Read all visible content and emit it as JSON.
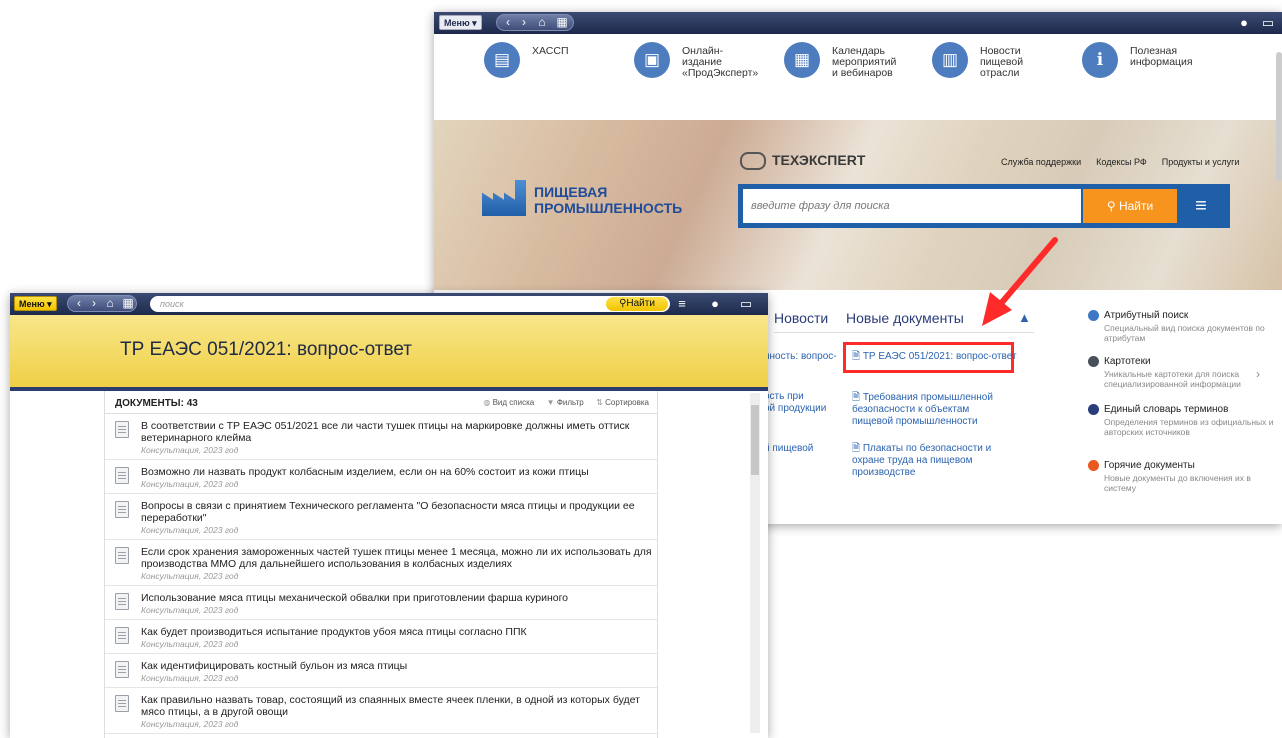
{
  "back_window": {
    "toolbar": {
      "menu_label": "Меню ▾"
    },
    "categories": [
      {
        "icon": "folder-icon",
        "glyph": "▤",
        "label": "ХАССП"
      },
      {
        "icon": "monitor-icon",
        "glyph": "▣",
        "label": "Онлайн-издание\n«ПродЭксперт»"
      },
      {
        "icon": "calendar-icon",
        "glyph": "▦",
        "label": "Календарь\nмероприятий\nи вебинаров"
      },
      {
        "icon": "news-icon",
        "glyph": "▥",
        "label": "Новости пищевой\nотрасли"
      },
      {
        "icon": "info-icon",
        "glyph": "ℹ",
        "label": "Полезная\nинформация"
      }
    ],
    "banner": {
      "brand": "ТЕХЭКСПЕRТ",
      "logo_line1": "ПИЩЕВАЯ",
      "logo_line2": "ПРОМЫШЛЕННОСТЬ",
      "links": [
        "Служба поддержки",
        "Кодексы РФ",
        "Продукты и услуги"
      ],
      "search_placeholder": "введите фразу для поиска",
      "search_button": "Найти"
    },
    "tabs": {
      "news": "Новости",
      "new_docs": "Новые документы"
    },
    "news_items": [
      "нность: вопрос-",
      "ость при\nой продукции",
      "й пищевой"
    ],
    "new_docs": [
      "ТР ЕАЭС 051/2021: вопрос-ответ",
      "Требования промышленной безопасности к объектам пищевой промышленности",
      "Плакаты по безопасности и охране труда на пищевом производстве"
    ],
    "side": [
      {
        "title": "Атрибутный поиск",
        "desc": "Специальный вид поиска документов по атрибутам",
        "color": "#3d78c4"
      },
      {
        "title": "Картотеки",
        "desc": "Уникальные картотеки для поиска специализированной информации",
        "color": "#4a4f5c"
      },
      {
        "title": "Единый словарь терминов",
        "desc": "Определения терминов из официальных и авторских источников",
        "color": "#2b3c7a"
      },
      {
        "title": "Горячие документы",
        "desc": "Новые документы до включения их в систему",
        "color": "#e8581f"
      }
    ]
  },
  "front_window": {
    "toolbar": {
      "menu_label": "Меню ▾",
      "search_placeholder": "поиск",
      "find_button": "Найти"
    },
    "page_title": "ТР ЕАЭС 051/2021: вопрос-ответ",
    "docs_header": "ДОКУМЕНТЫ: 43",
    "view_list": "Вид списка",
    "filter": "Фильтр",
    "sort": "Сортировка",
    "documents": [
      {
        "title": "В соответствии с ТР ЕАЭС 051/2021 все ли части тушек птицы на маркировке должны иметь оттиск ветеринарного клейма",
        "sub": "Консультация, 2023 год"
      },
      {
        "title": "Возможно ли назвать продукт колбасным изделием, если он на 60% состоит из кожи птицы",
        "sub": "Консультация, 2023 год"
      },
      {
        "title": "Вопросы в связи с принятием Технического регламента \"О безопасности мяса птицы и продукции ее переработки\"",
        "sub": "Консультация, 2023 год"
      },
      {
        "title": "Если срок хранения замороженных частей тушек птицы менее 1 месяца, можно ли их использовать для производства ММО для дальнейшего использования в колбасных изделиях",
        "sub": "Консультация, 2023 год"
      },
      {
        "title": "Использование мяса птицы механической обвалки при приготовлении фарша куриного",
        "sub": "Консультация, 2023 год"
      },
      {
        "title": "Как будет производиться испытание продуктов убоя мяса птицы согласно ППК",
        "sub": "Консультация, 2023 год"
      },
      {
        "title": "Как идентифицировать костный бульон из мяса птицы",
        "sub": "Консультация, 2023 год"
      },
      {
        "title": "Как правильно назвать товар, состоящий из спаянных вместе ячеек пленки, в одной из которых будет мясо птицы, а в другой овощи",
        "sub": "Консультация, 2023 год"
      }
    ]
  },
  "colors": {
    "toolbar": "#1e2a4c",
    "accent_orange": "#f7941d",
    "link": "#2c63b0",
    "highlight": "#ff2a2a",
    "title_band": "#f5d95a"
  }
}
